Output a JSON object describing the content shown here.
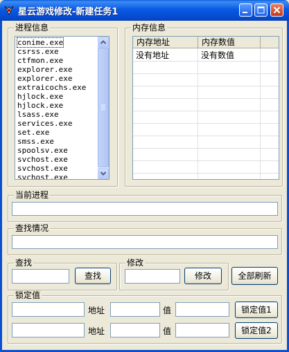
{
  "window": {
    "title": "星云游戏修改-新建任务1",
    "accent": "#0a5ae3"
  },
  "process_group": {
    "label": "进程信息",
    "items": [
      "conime.exe",
      "csrss.exe",
      "ctfmon.exe",
      "explorer.exe",
      "explorer.exe",
      "extraicochs.exe",
      "hjlock.exe",
      "hjlock.exe",
      "lsass.exe",
      "services.exe",
      "set.exe",
      "smss.exe",
      "spoolsv.exe",
      "svchost.exe",
      "svchost.exe",
      "svchost.exe"
    ],
    "selected_item": "conime.exe"
  },
  "memory_group": {
    "label": "内存信息",
    "columns": [
      "内存地址",
      "内存数值"
    ],
    "rows": [
      [
        "没有地址",
        "没有数值"
      ]
    ]
  },
  "current_process": {
    "label": "当前进程",
    "value": ""
  },
  "search_status": {
    "label": "查找情况",
    "value": ""
  },
  "find": {
    "label": "查找",
    "value": "",
    "button": "查找"
  },
  "modify": {
    "label": "修改",
    "value": "",
    "button": "修改"
  },
  "refresh_all_button": "全部刷新",
  "lock": {
    "label": "锁定值",
    "address_label": "地址",
    "value_label": "值",
    "rows": [
      {
        "name": "",
        "address": "",
        "value": "",
        "button": "锁定值1"
      },
      {
        "name": "",
        "address": "",
        "value": "",
        "button": "锁定值2"
      }
    ]
  }
}
